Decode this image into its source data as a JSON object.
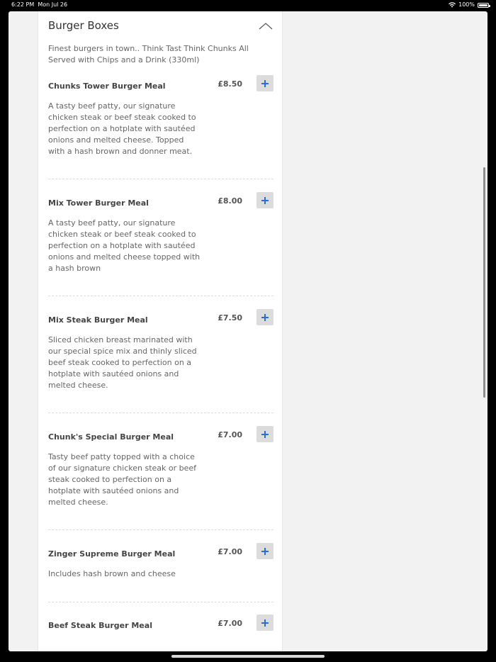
{
  "status": {
    "time": "6:22 PM",
    "date": "Mon Jul 26",
    "battery": "100%"
  },
  "section": {
    "title": "Burger Boxes",
    "description": "Finest burgers in town.. Think Tast Think Chunks All Served with Chips and a Drink (330ml)"
  },
  "items": [
    {
      "name": "Chunks Tower Burger Meal",
      "price": "£8.50",
      "description": "A tasty beef patty, our signature chicken steak or beef steak cooked to perfection on a hotplate with sautéed onions and melted cheese. Topped with a hash brown and donner meat."
    },
    {
      "name": "Mix Tower Burger Meal",
      "price": "£8.00",
      "description": "A tasty beef patty, our signature chicken steak or beef steak cooked to perfection on a hotplate with sautéed onions and melted cheese topped with a hash brown"
    },
    {
      "name": "Mix Steak Burger Meal",
      "price": "£7.50",
      "description": "Sliced chicken breast marinated with our special spice mix and thinly sliced beef steak cooked to perfection on a hotplate with sautéed onions and melted cheese."
    },
    {
      "name": "Chunk's Special Burger Meal",
      "price": "£7.00",
      "description": "Tasty beef patty topped with a choice of our signature chicken steak or beef steak cooked to perfection on a hotplate with sautéed onions and melted cheese."
    },
    {
      "name": "Zinger Supreme Burger Meal",
      "price": "£7.00",
      "description": "Includes hash brown and cheese"
    },
    {
      "name": "Beef Steak Burger Meal",
      "price": "£7.00",
      "description": ""
    }
  ],
  "colors": {
    "accent": "#2a6fcf",
    "button_bg": "#dcdcdc"
  },
  "icons": {
    "add": "plus-icon",
    "collapse": "chevron-up-icon"
  }
}
